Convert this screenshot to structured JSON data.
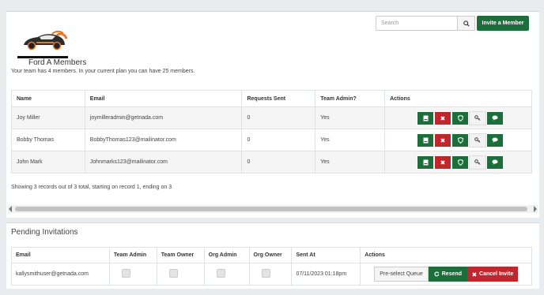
{
  "header": {
    "search_placeholder": "Search",
    "invite_label": "Invite a Member"
  },
  "team": {
    "title": "Ford A Members",
    "subtitle": "Your team has 4 members. In your current plan you can have 25 members."
  },
  "members_table": {
    "columns": [
      "Name",
      "Email",
      "Requests Sent",
      "Team Admin?",
      "Actions"
    ],
    "rows": [
      {
        "name": "Joy Miller",
        "email": "joymilleradmin@getnada.com",
        "requests": "0",
        "admin": "Yes"
      },
      {
        "name": "Bobby Thomas",
        "email": "BobbyThomas123@mailinator.com",
        "requests": "0",
        "admin": "Yes"
      },
      {
        "name": "John Mark",
        "email": "Johnmarks123@mailinator.com",
        "requests": "0",
        "admin": "Yes"
      }
    ],
    "actions_icons": [
      "document-icon",
      "x-icon",
      "shield-icon",
      "key-icon",
      "chat-icon"
    ]
  },
  "records_text": "Showing 3 records out of 3 total, starting on record 1, ending on 3",
  "pending": {
    "title": "Pending Invitations",
    "columns": [
      "Email",
      "Team Admin",
      "Team Owner",
      "Org Admin",
      "Org Owner",
      "Sent At",
      "Actions"
    ],
    "rows": [
      {
        "email": "kallysmithuser@getnada.com",
        "sent_at": "07/11/2023 01:18pm"
      }
    ],
    "preselect_label": "Pre-select Queue",
    "resend_label": "Resend",
    "cancel_label": "Cancel Invite"
  },
  "colors": {
    "green": "#1c6e3a",
    "red": "#c0262c"
  }
}
